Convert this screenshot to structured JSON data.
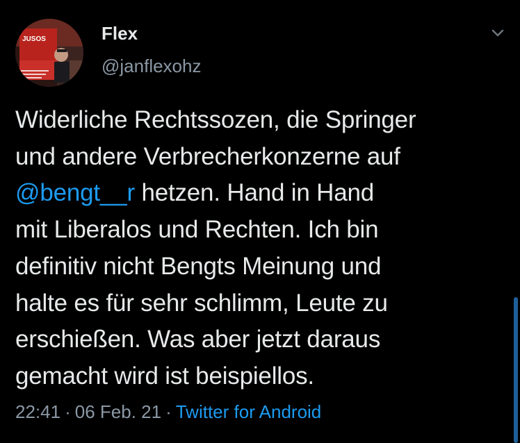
{
  "colors": {
    "background": "#000000",
    "text": "#e7e9ea",
    "secondary_text": "#8b98a5",
    "link": "#1d9bf0"
  },
  "author": {
    "display_name": "Flex",
    "handle": "@janflexohz",
    "avatar_text": "JUSOS"
  },
  "tweet": {
    "lines": [
      "Widerliche Rechtssozen, die Springer",
      "und andere Verbrecherkonzerne auf",
      "hetzen. Hand in Hand",
      "mit Liberalos und Rechten. Ich bin",
      "definitiv nicht Bengts Meinung und",
      "halte es für sehr schlimm, Leute zu",
      "erschießen. Was aber jetzt daraus",
      "gemacht wird ist beispiellos."
    ],
    "mention": "@bengt__r"
  },
  "meta": {
    "time": "22:41",
    "separator": "·",
    "date": "06 Feb. 21",
    "source": "Twitter for Android"
  },
  "icons": {
    "menu": "chevron-down-icon"
  }
}
